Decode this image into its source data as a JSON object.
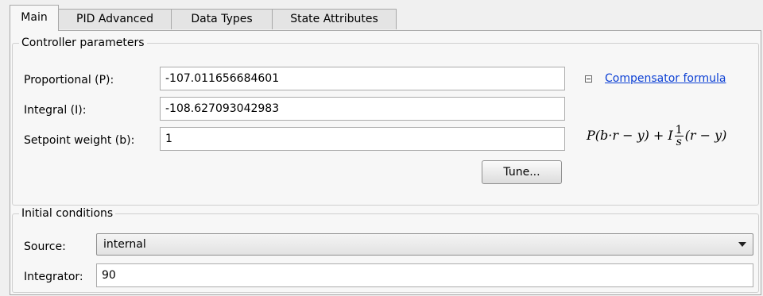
{
  "tabs": [
    {
      "label": "Main"
    },
    {
      "label": "PID Advanced"
    },
    {
      "label": "Data Types"
    },
    {
      "label": "State Attributes"
    }
  ],
  "controller": {
    "title": "Controller parameters",
    "proportional": {
      "label": "Proportional (P):",
      "value": "-107.011656684601"
    },
    "integral": {
      "label": "Integral (I):",
      "value": "-108.627093042983"
    },
    "setpoint": {
      "label": "Setpoint weight (b):",
      "value": "1"
    },
    "tune_label": "Tune...",
    "compensator_link": "Compensator formula",
    "formula": {
      "left": "P(b·r − y) + I",
      "num": "1",
      "den": "s",
      "right": "(r − y)"
    }
  },
  "initial": {
    "title": "Initial conditions",
    "source": {
      "label": "Source:",
      "value": "internal"
    },
    "integrator": {
      "label": "Integrator:",
      "value": "90"
    }
  },
  "icons": {
    "collapse": "collapse-minus-icon",
    "dropdown": "chevron-down-icon"
  }
}
